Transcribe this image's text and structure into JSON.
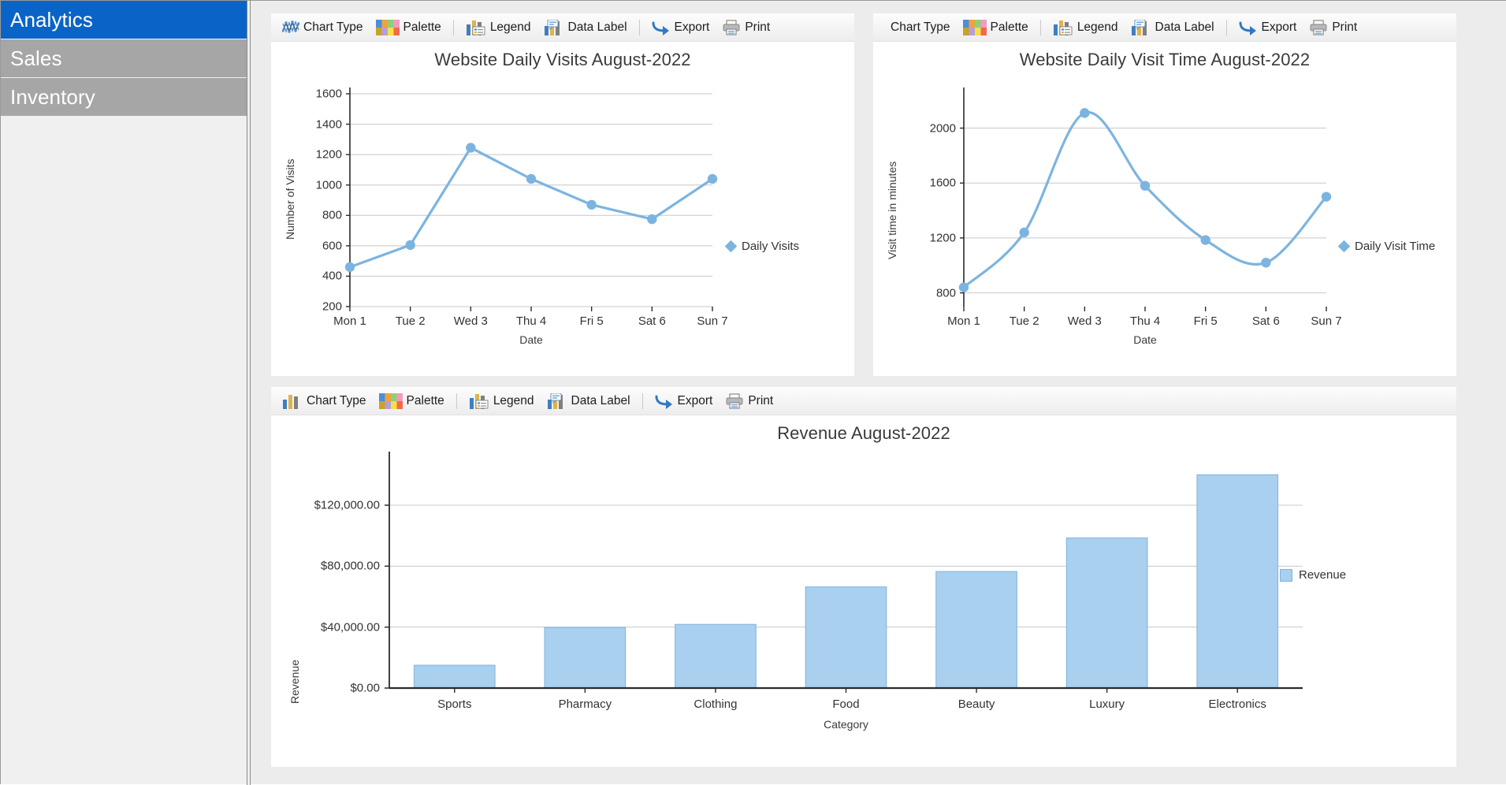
{
  "sidebar": {
    "items": [
      {
        "label": "Analytics",
        "state": "selected"
      },
      {
        "label": "Sales",
        "state": "idle"
      },
      {
        "label": "Inventory",
        "state": "idle"
      }
    ]
  },
  "toolbar": {
    "chart_type": "Chart Type",
    "palette": "Palette",
    "legend": "Legend",
    "data_label": "Data Label",
    "export": "Export",
    "print": "Print",
    "icons": {
      "chart_type_spline": "spline-chart-icon",
      "chart_type_column": "column-chart-icon",
      "palette": "palette-icon",
      "legend": "legend-icon",
      "data_label": "data-label-icon",
      "export": "export-arrow-icon",
      "print": "printer-icon"
    }
  },
  "colors": {
    "accent": "#0a64c8",
    "sidebar_idle": "#a6a6a6",
    "line": "#7cb4e0",
    "marker": "#7cb4e0",
    "bar_fill": "#a9d0ee",
    "bar_stroke": "#7fb4dd",
    "grid": "#c8c8c8",
    "axis": "#2b2b2b",
    "panel_bg": "#ffffff",
    "content_bg": "#ececec"
  },
  "chart_data": [
    {
      "id": "daily-visits",
      "type": "line",
      "title": "Website Daily Visits August-2022",
      "xlabel": "Date",
      "ylabel": "Number of Visits",
      "categories": [
        "Mon 1",
        "Tue 2",
        "Wed 3",
        "Thu 4",
        "Fri 5",
        "Sat 6",
        "Sun 7"
      ],
      "values": [
        460,
        605,
        1245,
        1040,
        870,
        775,
        1040
      ],
      "ylim": [
        200,
        1600
      ],
      "yticks": [
        200,
        400,
        600,
        800,
        1000,
        1200,
        1400,
        1600
      ],
      "ytick_labels": [
        "200",
        "400",
        "600",
        "800",
        "1000",
        "1200",
        "1400",
        "1600"
      ],
      "grid": true,
      "legend": [
        "Daily Visits"
      ],
      "legend_position": "right",
      "marker": "circle",
      "smooth": false
    },
    {
      "id": "daily-visit-time",
      "type": "line",
      "title": "Website Daily Visit Time August-2022",
      "xlabel": "Date",
      "ylabel": "Visit time in minutes",
      "categories": [
        "Mon 1",
        "Tue 2",
        "Wed 3",
        "Thu 4",
        "Fri 5",
        "Sat 6",
        "Sun 7"
      ],
      "values": [
        840,
        1240,
        2110,
        1580,
        1185,
        1020,
        1500
      ],
      "ylim": [
        700,
        2250
      ],
      "yticks": [
        800,
        1200,
        1600,
        2000
      ],
      "ytick_labels": [
        "800",
        "1200",
        "1600",
        "2000"
      ],
      "grid": true,
      "legend": [
        "Daily Visit Time"
      ],
      "legend_position": "right",
      "marker": "circle",
      "smooth": true
    },
    {
      "id": "revenue",
      "type": "bar",
      "title": "Revenue August-2022",
      "xlabel": "Category",
      "ylabel": "Revenue",
      "categories": [
        "Sports",
        "Pharmacy",
        "Clothing",
        "Food",
        "Beauty",
        "Luxury",
        "Electronics"
      ],
      "values": [
        15000,
        39800,
        41800,
        66400,
        76500,
        98500,
        140000
      ],
      "ylim": [
        0,
        150000
      ],
      "yticks": [
        0,
        40000,
        80000,
        120000
      ],
      "ytick_labels": [
        "$0.00",
        "$40,000.00",
        "$80,000.00",
        "$120,000.00"
      ],
      "grid": true,
      "legend": [
        "Revenue"
      ],
      "legend_position": "right"
    }
  ]
}
